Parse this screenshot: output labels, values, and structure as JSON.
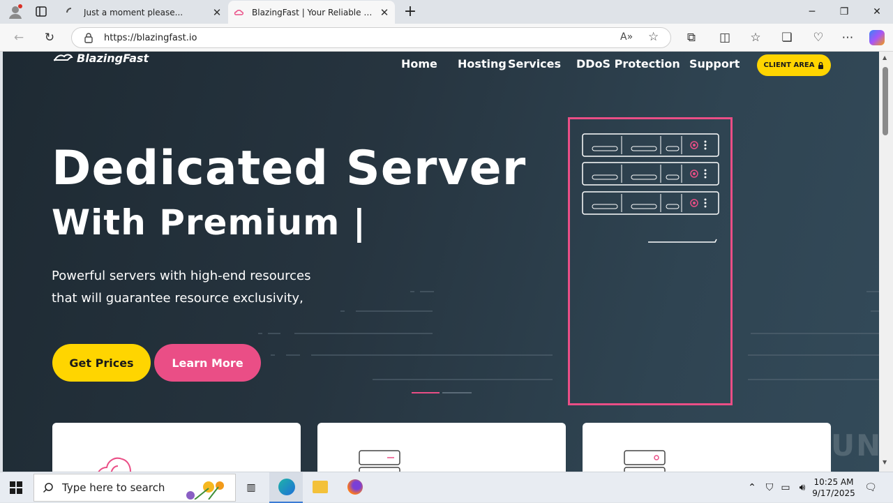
{
  "browser": {
    "tabs": [
      {
        "title": "Just a moment please..."
      },
      {
        "title": "BlazingFast | Your Reliable Hosting"
      }
    ],
    "new_tab_label": "+",
    "url": "https://blazingfast.io"
  },
  "site": {
    "logo_text": "BlazingFast",
    "nav": [
      "Home",
      "Hosting",
      "Services",
      "DDoS Protection",
      "Support"
    ],
    "client_area_label": "CLIENT AREA",
    "hero": {
      "title": "Dedicated Server",
      "subtitle": "With Premium |",
      "lead_line1": "Powerful servers with high-end resources",
      "lead_line2": "that will guarantee resource exclusivity,",
      "primary_button": "Get Prices",
      "secondary_button": "Learn More"
    },
    "colors": {
      "accent_yellow": "#ffd500",
      "accent_pink": "#ea4e86"
    }
  },
  "watermark": "ANY RUN",
  "taskbar": {
    "search_placeholder": "Type here to search",
    "time": "10:25 AM",
    "date": "9/17/2025"
  }
}
